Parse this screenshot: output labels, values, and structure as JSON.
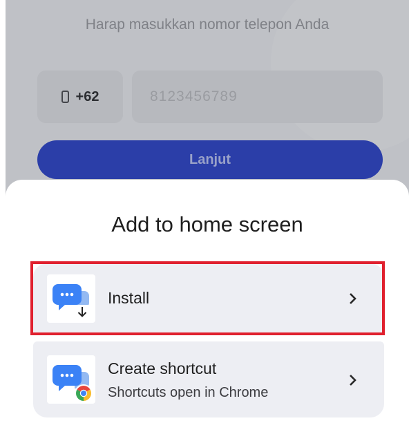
{
  "page": {
    "subtitle": "Harap masukkan nomor telepon Anda",
    "country_code": "+62",
    "phone_placeholder": "8123456789",
    "continue_label": "Lanjut"
  },
  "sheet": {
    "title": "Add to home screen",
    "options": [
      {
        "title": "Install",
        "icon": "chat-app-install-icon"
      },
      {
        "title": "Create shortcut",
        "subtitle": "Shortcuts open in Chrome",
        "icon": "chat-app-chrome-icon"
      }
    ]
  },
  "colors": {
    "highlight": "#e0202e",
    "continue_button": "#2b3ea8",
    "card_background": "#edeef3",
    "app_icon_blue": "#3b82f6"
  }
}
